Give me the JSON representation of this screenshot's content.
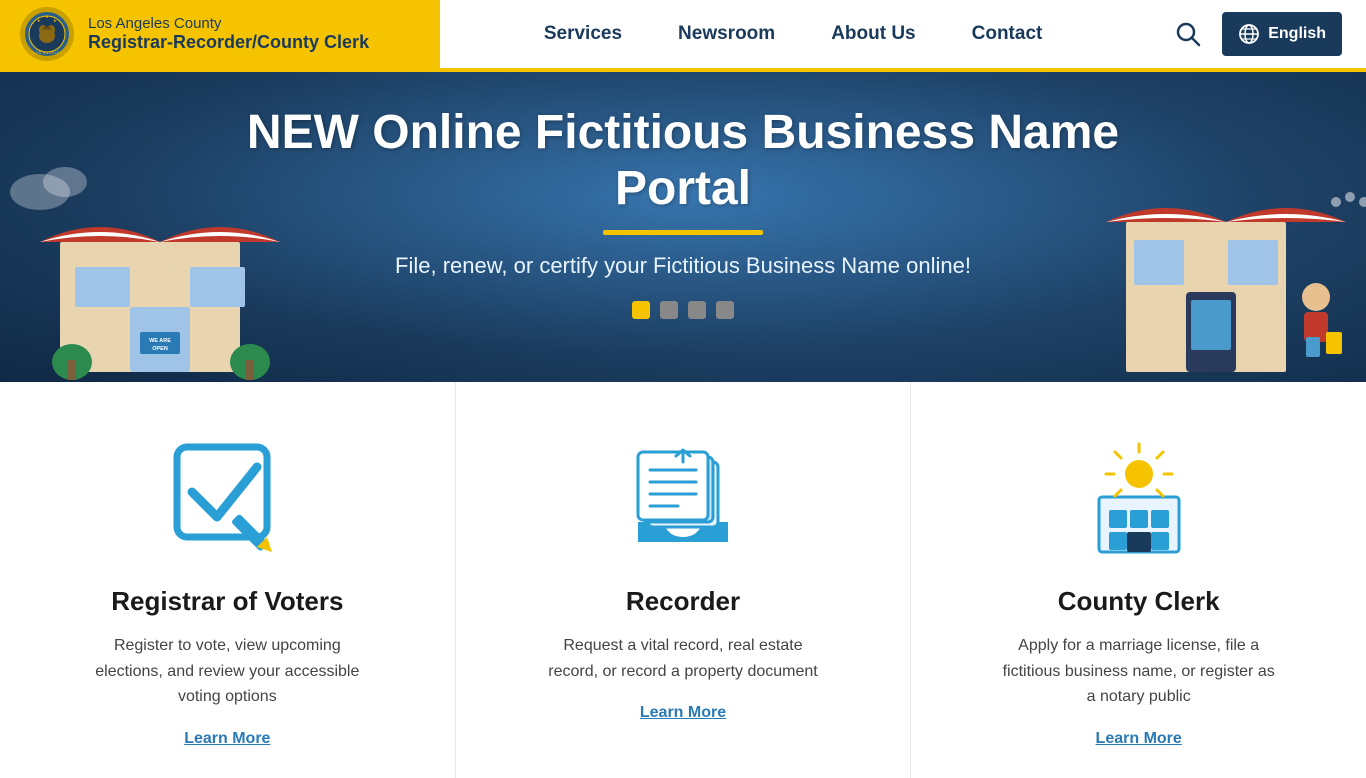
{
  "header": {
    "org_line1": "Los Angeles County",
    "org_line2": "Registrar-Recorder/County Clerk",
    "nav": [
      {
        "label": "Services",
        "id": "services"
      },
      {
        "label": "Newsroom",
        "id": "newsroom"
      },
      {
        "label": "About Us",
        "id": "about"
      },
      {
        "label": "Contact",
        "id": "contact"
      }
    ],
    "search_label": "Search",
    "language_label": "English"
  },
  "hero": {
    "title": "NEW Online Fictitious Business Name Portal",
    "subtitle": "File, renew, or certify your Fictitious Business Name online!",
    "dots": [
      {
        "active": true
      },
      {
        "active": false
      },
      {
        "active": false
      },
      {
        "active": false
      }
    ]
  },
  "cards": [
    {
      "id": "voters",
      "title": "Registrar of Voters",
      "description": "Register to vote, view upcoming elections, and review your accessible voting options",
      "link": "Learn More"
    },
    {
      "id": "recorder",
      "title": "Recorder",
      "description": "Request a vital record, real estate record, or record a property document",
      "link": "Learn More"
    },
    {
      "id": "clerk",
      "title": "County Clerk",
      "description": "Apply for a marriage license, file a fictitious business name, or register as a notary public",
      "link": "Learn More"
    }
  ]
}
